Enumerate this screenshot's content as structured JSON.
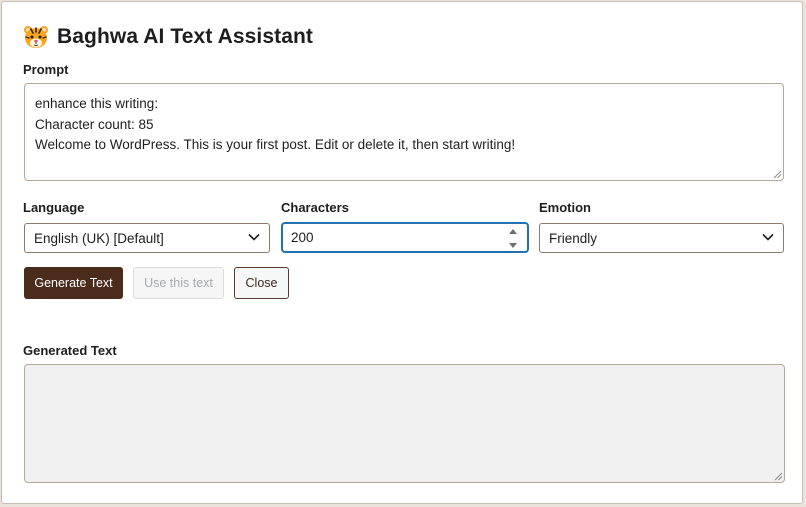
{
  "dialog": {
    "title": "Baghwa AI Text Assistant",
    "icon": "tiger-face-icon"
  },
  "prompt": {
    "label": "Prompt",
    "lines": [
      "enhance this writing:",
      "Character count: 85",
      "Welcome to WordPress. This is your first post. Edit or delete it, then start writing!"
    ]
  },
  "language": {
    "label": "Language",
    "selected": "English (UK) [Default]"
  },
  "characters": {
    "label": "Characters",
    "value": "200"
  },
  "emotion": {
    "label": "Emotion",
    "selected": "Friendly"
  },
  "buttons": {
    "generate": "Generate Text",
    "use": "Use this text",
    "close": "Close"
  },
  "generated": {
    "label": "Generated Text",
    "value": ""
  },
  "colors": {
    "primary_button": "#4a2b1c",
    "focus_border": "#2271b1",
    "disabled_fill": "#f0f0f0"
  }
}
